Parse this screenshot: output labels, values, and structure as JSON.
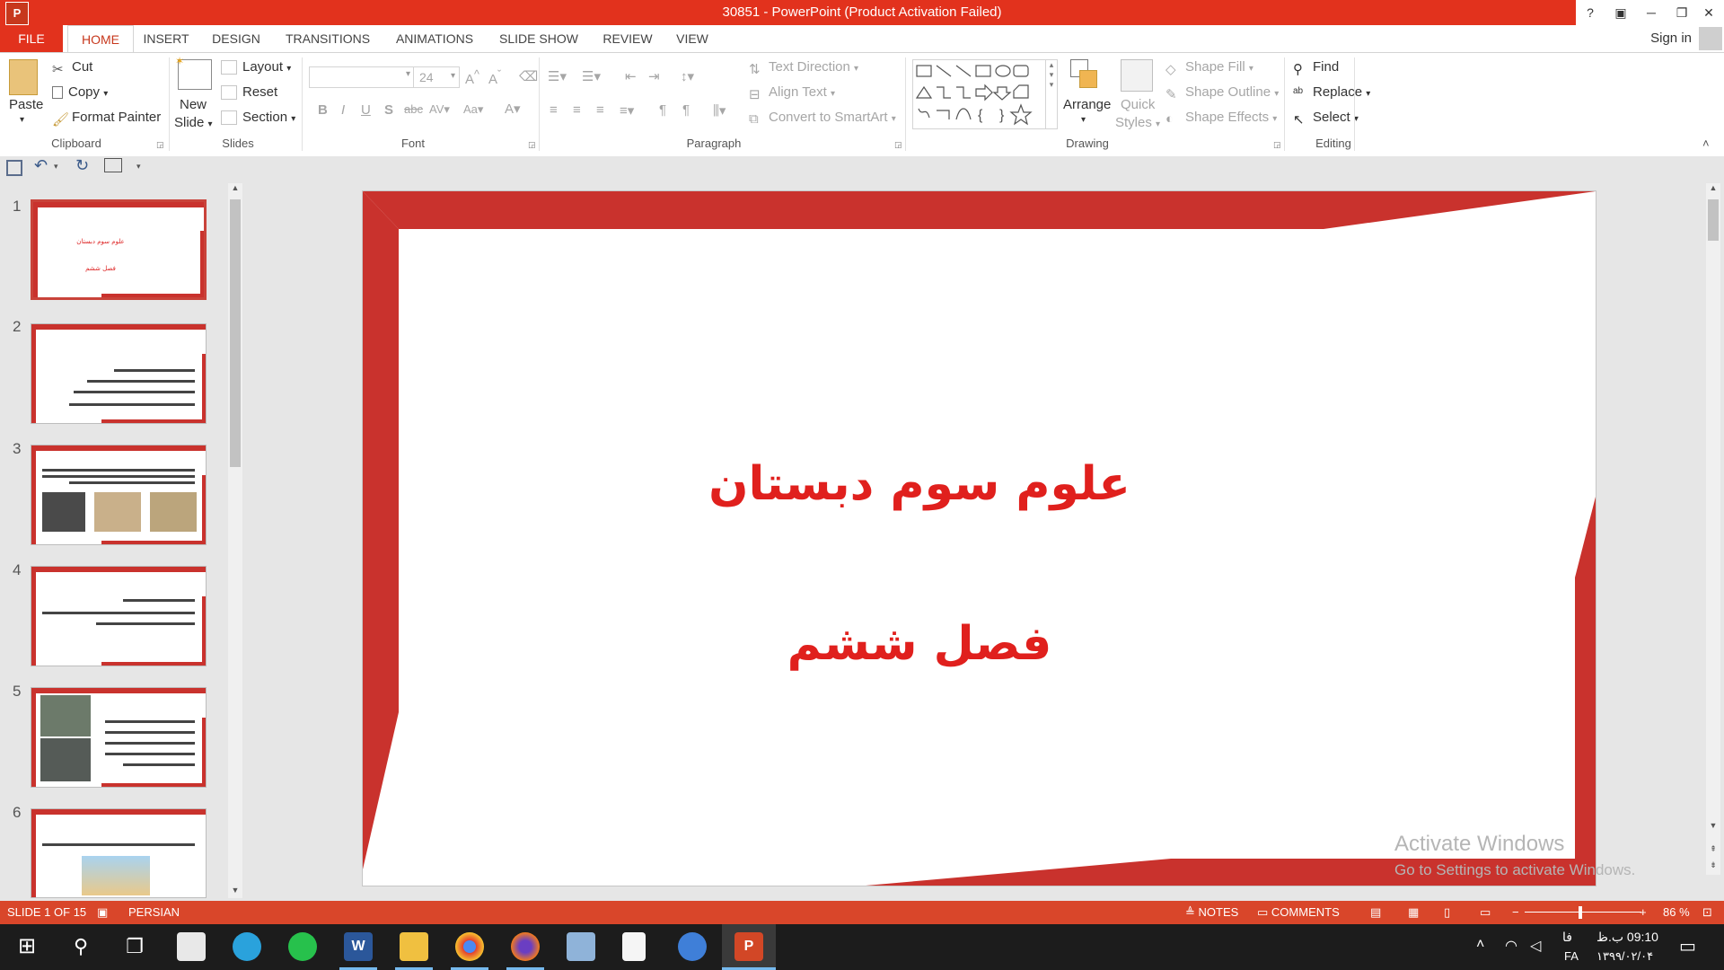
{
  "window": {
    "title": "30851 - PowerPoint (Product Activation Failed)",
    "app_icon": "P",
    "help": "?",
    "sign_in": "Sign in"
  },
  "tabs": [
    "FILE",
    "HOME",
    "INSERT",
    "DESIGN",
    "TRANSITIONS",
    "ANIMATIONS",
    "SLIDE SHOW",
    "REVIEW",
    "VIEW"
  ],
  "ribbon": {
    "clipboard": {
      "paste": "Paste",
      "cut": "Cut",
      "copy": "Copy",
      "format_painter": "Format Painter",
      "label": "Clipboard"
    },
    "slides": {
      "new_slide_1": "New",
      "new_slide_2": "Slide",
      "layout": "Layout",
      "reset": "Reset",
      "section": "Section",
      "label": "Slides"
    },
    "font": {
      "size": "24",
      "label": "Font"
    },
    "paragraph": {
      "text_direction": "Text Direction",
      "align_text": "Align Text",
      "convert_smartart": "Convert to SmartArt",
      "label": "Paragraph"
    },
    "drawing": {
      "arrange": "Arrange",
      "quick_1": "Quick",
      "quick_2": "Styles",
      "shape_fill": "Shape Fill",
      "shape_outline": "Shape Outline",
      "shape_effects": "Shape Effects",
      "label": "Drawing"
    },
    "editing": {
      "find": "Find",
      "replace": "Replace",
      "select": "Select",
      "label": "Editing"
    }
  },
  "thumbnails": [
    {
      "num": "1",
      "title": "علوم سوم دبستان",
      "subtitle": "فصل ششم"
    },
    {
      "num": "2"
    },
    {
      "num": "3"
    },
    {
      "num": "4"
    },
    {
      "num": "5"
    },
    {
      "num": "6"
    }
  ],
  "slide": {
    "title": "علوم سوم دبستان",
    "subtitle": "فصل ششم"
  },
  "watermark": {
    "line1": "Activate Windows",
    "line2": "Go to Settings to activate Windows."
  },
  "status": {
    "slide_info": "SLIDE 1 OF 15",
    "language": "PERSIAN",
    "notes": "NOTES",
    "comments": "COMMENTS",
    "zoom": "86 %"
  },
  "taskbar": {
    "time": "09:10 ب.ظ",
    "date": "۱۳۹۹/۰۲/۰۴",
    "lang_1": "فا",
    "lang_2": "FA"
  }
}
